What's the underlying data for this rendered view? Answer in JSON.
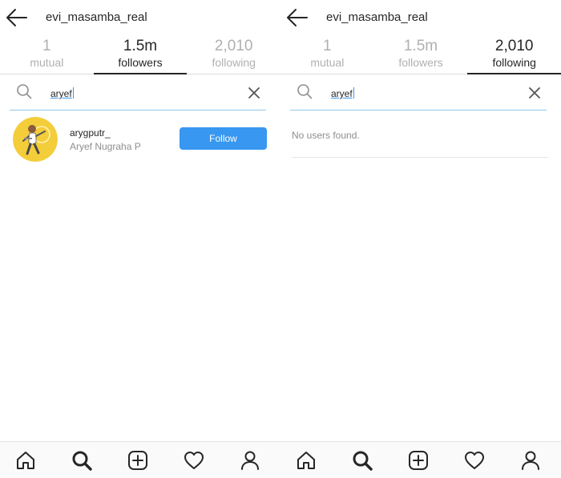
{
  "screens": [
    {
      "header": {
        "username": "evi_masamba_real"
      },
      "tabs": [
        {
          "count": "1",
          "label": "mutual",
          "active": false
        },
        {
          "count": "1.5m",
          "label": "followers",
          "active": true
        },
        {
          "count": "2,010",
          "label": "following",
          "active": false
        }
      ],
      "search": {
        "query": "aryef"
      },
      "results": [
        {
          "username": "arygputr_",
          "full_name": "Aryef Nugraha P",
          "follow_label": "Follow"
        }
      ]
    },
    {
      "header": {
        "username": "evi_masamba_real"
      },
      "tabs": [
        {
          "count": "1",
          "label": "mutual",
          "active": false
        },
        {
          "count": "1.5m",
          "label": "followers",
          "active": false
        },
        {
          "count": "2,010",
          "label": "following",
          "active": true
        }
      ],
      "search": {
        "query": "aryef"
      },
      "empty_message": "No users found."
    }
  ],
  "nav_icons": [
    "home-icon",
    "search-icon",
    "add-post-icon",
    "activity-heart-icon",
    "profile-icon"
  ],
  "colors": {
    "accent_blue": "#3897f0",
    "text": "#262626",
    "muted": "#8e8e8e"
  }
}
